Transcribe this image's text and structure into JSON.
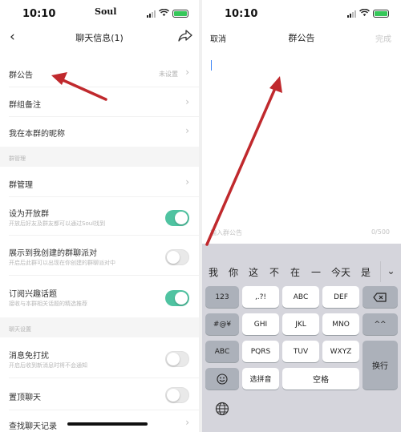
{
  "status": {
    "time": "10:10",
    "carrier": "Soul"
  },
  "colors": {
    "toggle_on": "#4fc3a1",
    "arrow": "#c0292d",
    "caret": "#3b83f6"
  },
  "left": {
    "nav": {
      "back_icon": "chevron-left-icon",
      "title": "聊天信息(1)",
      "action_icon": "share-icon"
    },
    "rows": {
      "announcement": {
        "label": "群公告",
        "value": "未设置"
      },
      "group_remark": {
        "label": "群组备注"
      },
      "my_nickname": {
        "label": "我在本群的昵称"
      },
      "management_header": "群管理",
      "group_management": {
        "label": "群管理"
      },
      "open_group": {
        "label": "设为开放群",
        "sub": "开放后好友及群友都可以通过Soul找到",
        "state": "on"
      },
      "show_party": {
        "label": "展示到我创建的群聊派对",
        "sub": "开启后此群可以出现在你创建的群聊派对中",
        "state": "off"
      },
      "subscribe": {
        "label": "订阅兴趣话题",
        "sub": "接收与本群相关话题的精选推荐",
        "state": "on"
      },
      "chat_header": "聊天设置",
      "mute": {
        "label": "消息免打扰",
        "sub": "开启后收到新消息时将不会通知",
        "state": "off"
      },
      "pin": {
        "label": "置顶聊天",
        "state": "off"
      },
      "history": {
        "label": "查找聊天记录"
      }
    }
  },
  "right": {
    "nav": {
      "cancel": "取消",
      "title": "群公告",
      "done": "完成"
    },
    "placeholder": "输入群公告",
    "counter": "0/500",
    "keyboard": {
      "candidates": [
        "我",
        "你",
        "这",
        "不",
        "在",
        "一",
        "今天",
        "是"
      ],
      "candidate_toggle_icon": "chevron-down-icon",
      "row1": [
        "123",
        ",.?!",
        "ABC",
        "DEF"
      ],
      "row2": [
        "#@¥",
        "GHI",
        "JKL",
        "MNO",
        "^^"
      ],
      "row3": [
        "ABC",
        "PQRS",
        "TUV",
        "WXYZ"
      ],
      "row4": [
        "选拼音",
        "空格"
      ],
      "enter": "换行",
      "backspace_icon": "backspace-icon",
      "emoji_icon": "emoji-icon",
      "globe_icon": "globe-icon"
    }
  }
}
